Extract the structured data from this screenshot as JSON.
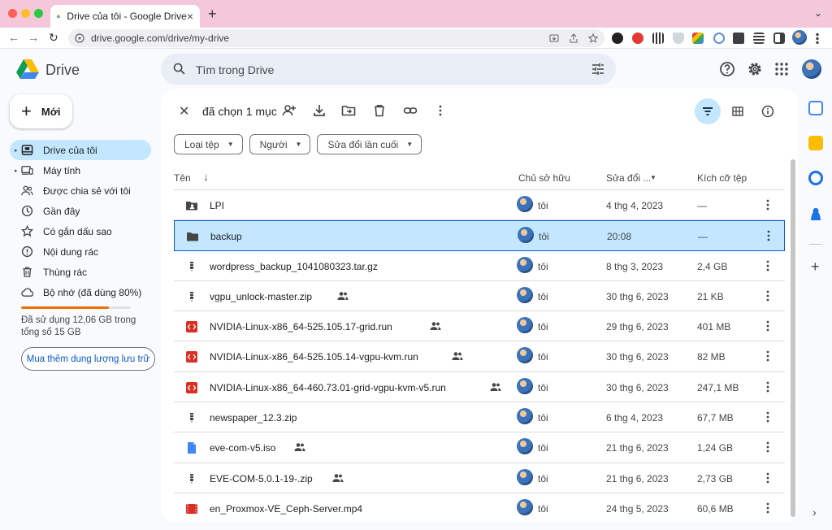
{
  "browser": {
    "tab_title": "Drive của tôi - Google Drive",
    "tab_close": "×",
    "new_tab": "+",
    "tabs_menu": "⌄",
    "url": "drive.google.com/drive/my-drive",
    "back": "←",
    "forward": "→",
    "reload": "↻"
  },
  "app": {
    "name": "Drive",
    "search_placeholder": "Tìm trong Drive",
    "new_button": "Mới",
    "new_plus": "+"
  },
  "sidebar": {
    "items": [
      {
        "label": "Drive của tôi",
        "icon": "my-drive-icon",
        "active": true,
        "caret": "▸"
      },
      {
        "label": "Máy tính",
        "icon": "computer-icon",
        "active": false,
        "caret": "▸"
      },
      {
        "label": "Được chia sẻ với tôi",
        "icon": "shared-people-icon",
        "active": false
      },
      {
        "label": "Gần đây",
        "icon": "clock-icon",
        "active": false
      },
      {
        "label": "Có gắn dấu sao",
        "icon": "star-icon",
        "active": false
      },
      {
        "label": "Nội dung rác",
        "icon": "spam-icon",
        "active": false
      },
      {
        "label": "Thùng rác",
        "icon": "trash-icon",
        "active": false
      },
      {
        "label": "Bộ nhớ (đã dùng 80%)",
        "icon": "cloud-icon",
        "active": false
      }
    ],
    "storage_fraction": 0.8,
    "storage_text": "Đã sử dụng 12,06 GB trong tổng số 15 GB",
    "buy_storage": "Mua thêm dung lượng lưu trữ"
  },
  "selection": {
    "close": "✕",
    "count_label": "đã chọn 1 mục"
  },
  "filters": [
    {
      "label": "Loại tệp",
      "arrow": "▼"
    },
    {
      "label": "Người",
      "arrow": "▼"
    },
    {
      "label": "Sửa đổi lần cuối",
      "arrow": "▼"
    }
  ],
  "table": {
    "headers": {
      "name": "Tên",
      "name_sort": "↓",
      "owner": "Chủ sở hữu",
      "modified": "Sửa đổi ...",
      "modified_sort": "▼",
      "size": "Kích cỡ tệp"
    },
    "rows": [
      {
        "name": "LPI",
        "type": "shared-folder",
        "shared": false,
        "owner": "tôi",
        "modified": "4 thg 4, 2023",
        "size": "—",
        "selected": false
      },
      {
        "name": "backup",
        "type": "folder",
        "shared": false,
        "owner": "tôi",
        "modified": "20:08",
        "size": "—",
        "selected": true
      },
      {
        "name": "wordpress_backup_1041080323.tar.gz",
        "type": "archive",
        "shared": false,
        "owner": "tôi",
        "modified": "8 thg 3, 2023",
        "size": "2,4 GB",
        "selected": false
      },
      {
        "name": "vgpu_unlock-master.zip",
        "type": "archive",
        "shared": true,
        "owner": "tôi",
        "modified": "30 thg 6, 2023",
        "size": "21 KB",
        "selected": false
      },
      {
        "name": "NVIDIA-Linux-x86_64-525.105.17-grid.run",
        "type": "code",
        "shared": true,
        "owner": "tôi",
        "modified": "29 thg 6, 2023",
        "size": "401 MB",
        "selected": false
      },
      {
        "name": "NVIDIA-Linux-x86_64-525.105.14-vgpu-kvm.run",
        "type": "code",
        "shared": true,
        "owner": "tôi",
        "modified": "30 thg 6, 2023",
        "size": "82 MB",
        "selected": false
      },
      {
        "name": "NVIDIA-Linux-x86_64-460.73.01-grid-vgpu-kvm-v5.run",
        "type": "code",
        "shared": true,
        "owner": "tôi",
        "modified": "30 thg 6, 2023",
        "size": "247,1 MB",
        "selected": false
      },
      {
        "name": "newspaper_12.3.zip",
        "type": "archive",
        "shared": false,
        "owner": "tôi",
        "modified": "6 thg 4, 2023",
        "size": "67,7 MB",
        "selected": false
      },
      {
        "name": "eve-com-v5.iso",
        "type": "doc",
        "shared": true,
        "owner": "tôi",
        "modified": "21 thg 6, 2023",
        "size": "1,24 GB",
        "selected": false
      },
      {
        "name": "EVE-COM-5.0.1-19-.zip",
        "type": "archive",
        "shared": true,
        "owner": "tôi",
        "modified": "21 thg 6, 2023",
        "size": "2,73 GB",
        "selected": false
      },
      {
        "name": "en_Proxmox-VE_Ceph-Server.mp4",
        "type": "video",
        "shared": false,
        "owner": "tôi",
        "modified": "24 thg 5, 2023",
        "size": "60,6 MB",
        "selected": false
      }
    ]
  },
  "colors": {
    "accent": "#0b57d0",
    "selected_bg": "#c2e7ff",
    "tabbar_bg": "#f5c7da",
    "code_icon": "#d93025",
    "doc_icon": "#4285f4",
    "storage_fill": "#e8710a"
  },
  "right_panel": {
    "expand": "›"
  }
}
